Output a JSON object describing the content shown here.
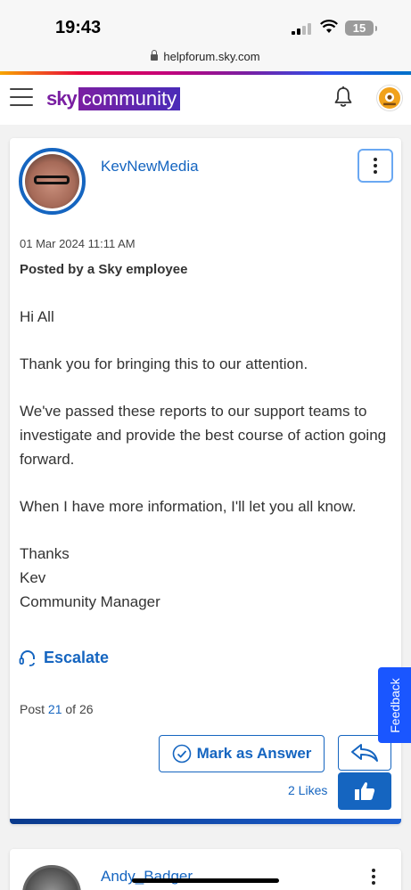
{
  "status": {
    "time": "19:43",
    "battery": "15",
    "url": "helpforum.sky.com"
  },
  "header": {
    "logo_sky": "sky",
    "logo_community": "community"
  },
  "post": {
    "username": "KevNewMedia",
    "date": "01 Mar 2024 11:11 AM",
    "posted_by": "Posted by a Sky employee",
    "greeting": "Hi All",
    "para1": "Thank you for bringing this to our attention.",
    "para2": "We've passed these reports to our support teams to investigate and provide the best course of action going forward.",
    "para3": "When I have more information, I'll let you all know.",
    "sign1": "Thanks",
    "sign2": "Kev",
    "sign3": "Community Manager",
    "escalate": "Escalate",
    "post_prefix": "Post ",
    "post_number": "21",
    "post_suffix": " of 26",
    "mark_answer": "Mark as Answer",
    "likes": "2 Likes"
  },
  "feedback": "Feedback",
  "next_post": {
    "username": "Andy_Badger"
  },
  "colors": {
    "accent": "#1565c0",
    "brand_purple": "#7a1fa2",
    "feedback_bg": "#1a56ff"
  }
}
